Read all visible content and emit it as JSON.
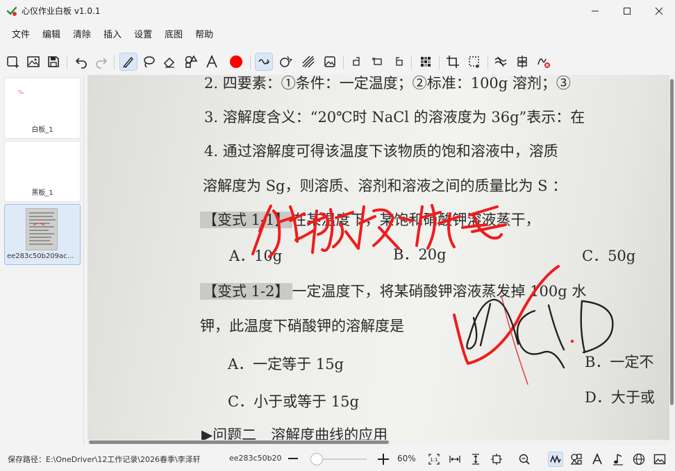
{
  "window": {
    "title": "心仪作业白板 v1.0.1"
  },
  "menu": [
    "文件",
    "编辑",
    "清除",
    "插入",
    "设置",
    "底图",
    "帮助"
  ],
  "toolbar_icons": [
    "new-board-icon",
    "insert-image-icon",
    "save-icon",
    "undo-icon",
    "redo-icon",
    "pen-icon",
    "lasso-icon",
    "eraser-icon",
    "shapes-icon",
    "text-icon",
    "color-icon",
    "smooth-ink-icon",
    "select-shape-icon",
    "hatch-icon",
    "image-frame-icon",
    "rotate-left-icon",
    "rotate-icon",
    "rotate-right-icon",
    "mosaic-icon",
    "crop-icon",
    "region-select-icon",
    "wave-icon",
    "align-icon",
    "clear-ink-icon"
  ],
  "accent_color": "#ff0000",
  "sidebar": {
    "items": [
      {
        "label": "白板_1"
      },
      {
        "label": "黑板_1"
      },
      {
        "label": "ee283c50b209ac9..."
      }
    ]
  },
  "document": {
    "lines": [
      "2. 四要素：①条件：一定温度；②标准：100g 溶剂；③",
      "3. 溶解度含义：“20℃时 NaCl 的溶液度为 36g”表示：在",
      "4. 通过溶解度可得该温度下该物质的饱和溶液中，溶质",
      "溶解度为 Sg，则溶质、溶剂和溶液之间的质量比为 S ：",
      "在某温度下，某饱和硝酸钾溶液蒸干，",
      "A．10g",
      "B．20g",
      "C．50g",
      "一定温度下，将某硝酸钾溶液蒸发掉 100g 水",
      "钾，此温度下硝酸钾的溶解度是",
      "A．一定等于 15g",
      "B．一定不",
      "C．小于或等于 15g",
      "D．大于或",
      "▶问题二　溶解度曲线的应用"
    ],
    "tag1": "【变式 1-1】",
    "tag2": "【变式 1-2】"
  },
  "status": {
    "path": "保存路径：E:\\OneDriver\\12工作记录\\2026春季\\李泽轩",
    "file": "ee283c50b20",
    "zoom": "60%",
    "zoom_level": 0.1
  }
}
